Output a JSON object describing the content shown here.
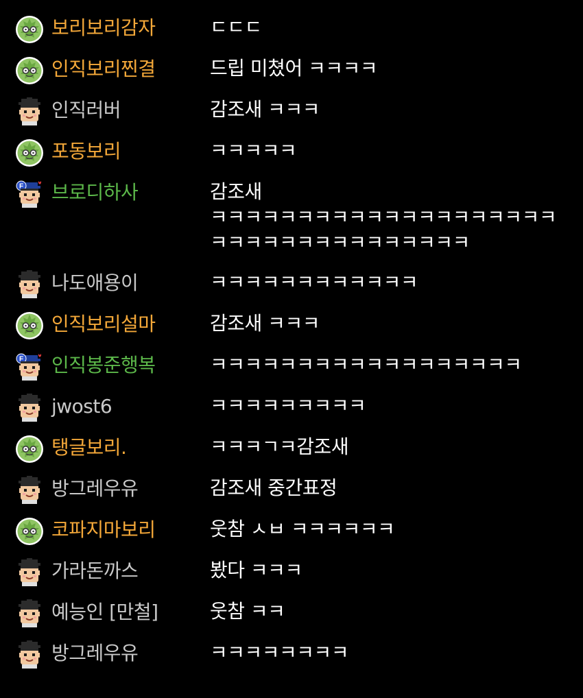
{
  "chat": {
    "messages": [
      {
        "nickname": "보리보리감자",
        "tier": "barley",
        "icon": "barley-badge-icon",
        "text": "ㄷㄷㄷ"
      },
      {
        "nickname": "인직보리찐결",
        "tier": "barley",
        "icon": "barley-badge-icon",
        "text": "드립 미쳤어 ㅋㅋㅋㅋ"
      },
      {
        "nickname": "인직러버",
        "tier": "normal",
        "icon": "viewer-face-icon",
        "text": "감조새 ㅋㅋㅋ"
      },
      {
        "nickname": "포동보리",
        "tier": "barley",
        "icon": "barley-badge-icon",
        "text": "ㅋㅋㅋㅋㅋ"
      },
      {
        "nickname": "브로디하사",
        "tier": "fan",
        "icon": "fan-face-icon",
        "text": "감조새 ㅋㅋㅋㅋㅋㅋㅋㅋㅋㅋㅋㅋㅋㅋㅋㅋㅋㅋㅋㅋㅋㅋㅋㅋㅋㅋㅋㅋㅋㅋㅋㅋㅋㅋㅋ"
      },
      {
        "nickname": "나도애용이",
        "tier": "normal",
        "icon": "viewer-face-icon",
        "text": "ㅋㅋㅋㅋㅋㅋㅋㅋㅋㅋㅋㅋ"
      },
      {
        "nickname": "인직보리설마",
        "tier": "barley",
        "icon": "barley-badge-icon",
        "text": "감조새 ㅋㅋㅋ"
      },
      {
        "nickname": "인직봉준행복",
        "tier": "fan",
        "icon": "fan-face-icon",
        "text": "ㅋㅋㅋㅋㅋㅋㅋㅋㅋㅋㅋㅋㅋㅋㅋㅋㅋㅋ"
      },
      {
        "nickname": "jwost6",
        "tier": "normal",
        "icon": "viewer-face-icon",
        "text": "ㅋㅋㅋㅋㅋㅋㅋㅋㅋ"
      },
      {
        "nickname": "탱글보리.",
        "tier": "barley",
        "icon": "barley-badge-icon",
        "text": "ㅋㅋㅋㄱㅋ감조새"
      },
      {
        "nickname": "방그레우유",
        "tier": "normal",
        "icon": "viewer-face-icon",
        "text": "감조새 중간표정"
      },
      {
        "nickname": "코파지마보리",
        "tier": "barley",
        "icon": "barley-badge-icon",
        "text": "웃참 ㅅㅂ ㅋㅋㅋㅋㅋㅋ"
      },
      {
        "nickname": "가라돈까스",
        "tier": "normal",
        "icon": "viewer-face-icon",
        "text": "봤다 ㅋㅋㅋ"
      },
      {
        "nickname": "예능인 [만철]",
        "tier": "normal",
        "icon": "viewer-face-icon",
        "text": "웃참 ㅋㅋ"
      },
      {
        "nickname": "방그레우유",
        "tier": "normal",
        "icon": "viewer-face-icon",
        "text": "ㅋㅋㅋㅋㅋㅋㅋㅋ"
      }
    ]
  },
  "colors": {
    "background": "#000000",
    "barley_nickname": "#f4a839",
    "fan_nickname": "#5cb84a",
    "normal_nickname": "#c9c9c9",
    "message_text": "#ffffff"
  }
}
